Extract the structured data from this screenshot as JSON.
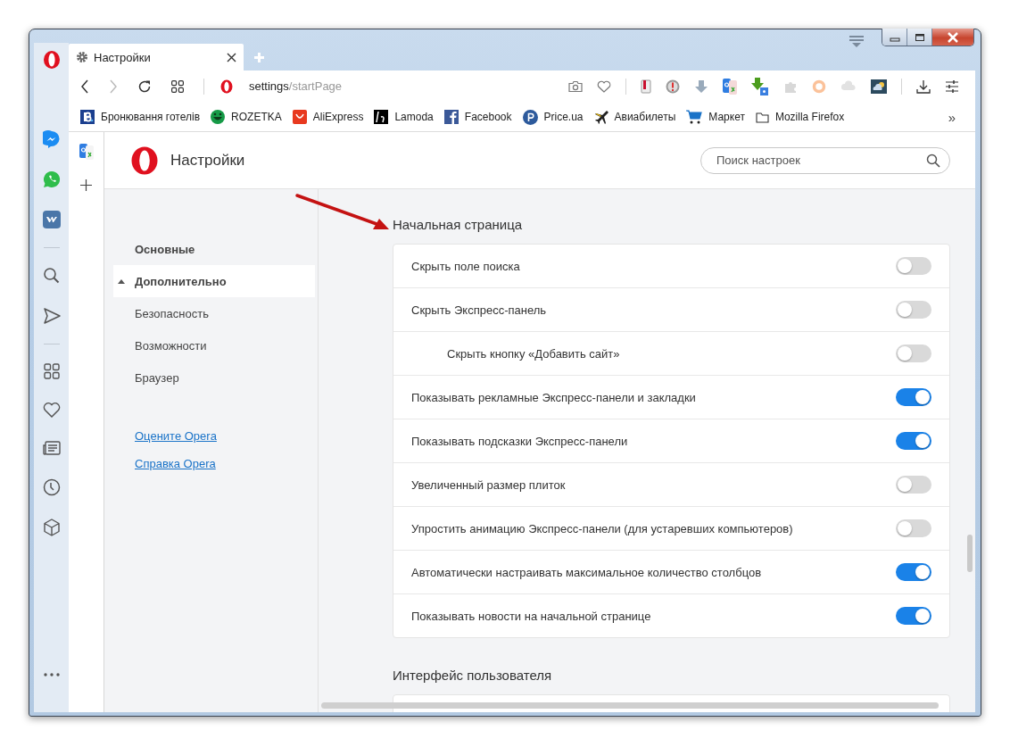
{
  "window": {
    "tab": {
      "title": "Настройки"
    },
    "address": {
      "host": "settings",
      "path": "/startPage"
    }
  },
  "bookmarks": [
    {
      "label": "Бронювання готелів",
      "kind": "booking"
    },
    {
      "label": "ROZETKA",
      "kind": "rozetka"
    },
    {
      "label": "AliExpress",
      "kind": "aliexpress"
    },
    {
      "label": "Lamoda",
      "kind": "lamoda"
    },
    {
      "label": "Facebook",
      "kind": "facebook"
    },
    {
      "label": "Price.ua",
      "kind": "price"
    },
    {
      "label": "Авиабилеты",
      "kind": "plane"
    },
    {
      "label": "Маркет",
      "kind": "cart"
    },
    {
      "label": "Mozilla Firefox",
      "kind": "folder"
    }
  ],
  "bookmarks_more": "»",
  "page": {
    "title": "Настройки",
    "search": {
      "placeholder": "Поиск настроек"
    }
  },
  "nav": [
    {
      "label": "Основные",
      "selected": false
    },
    {
      "label": "Дополнительно",
      "selected": true,
      "expanded": true,
      "children": [
        {
          "label": "Безопасность",
          "selected": false
        },
        {
          "label": "Возможности",
          "selected": false
        },
        {
          "label": "Браузер",
          "selected": false
        }
      ]
    }
  ],
  "links": [
    "Оцените Opera",
    "Справка Opera"
  ],
  "sections": [
    {
      "title": "Начальная страница",
      "settings": [
        {
          "label": "Скрыть поле поиска",
          "on": false
        },
        {
          "label": "Скрыть Экспресс-панель",
          "on": false,
          "children": [
            {
              "label": "Скрыть кнопку «Добавить сайт»",
              "on": false
            }
          ]
        },
        {
          "label": "Показывать рекламные Экспресс-панели и закладки",
          "on": true
        },
        {
          "label": "Показывать подсказки Экспресс-панели",
          "on": true
        },
        {
          "label": "Увеличенный размер плиток",
          "on": false
        },
        {
          "label": "Упростить анимацию Экспресс-панели (для устаревших компьютеров)",
          "on": false
        },
        {
          "label": "Автоматически настраивать максимальное количество столбцов",
          "on": true
        },
        {
          "label": "Показывать новости на начальной странице",
          "on": true
        }
      ]
    },
    {
      "title": "Интерфейс пользователя"
    }
  ]
}
